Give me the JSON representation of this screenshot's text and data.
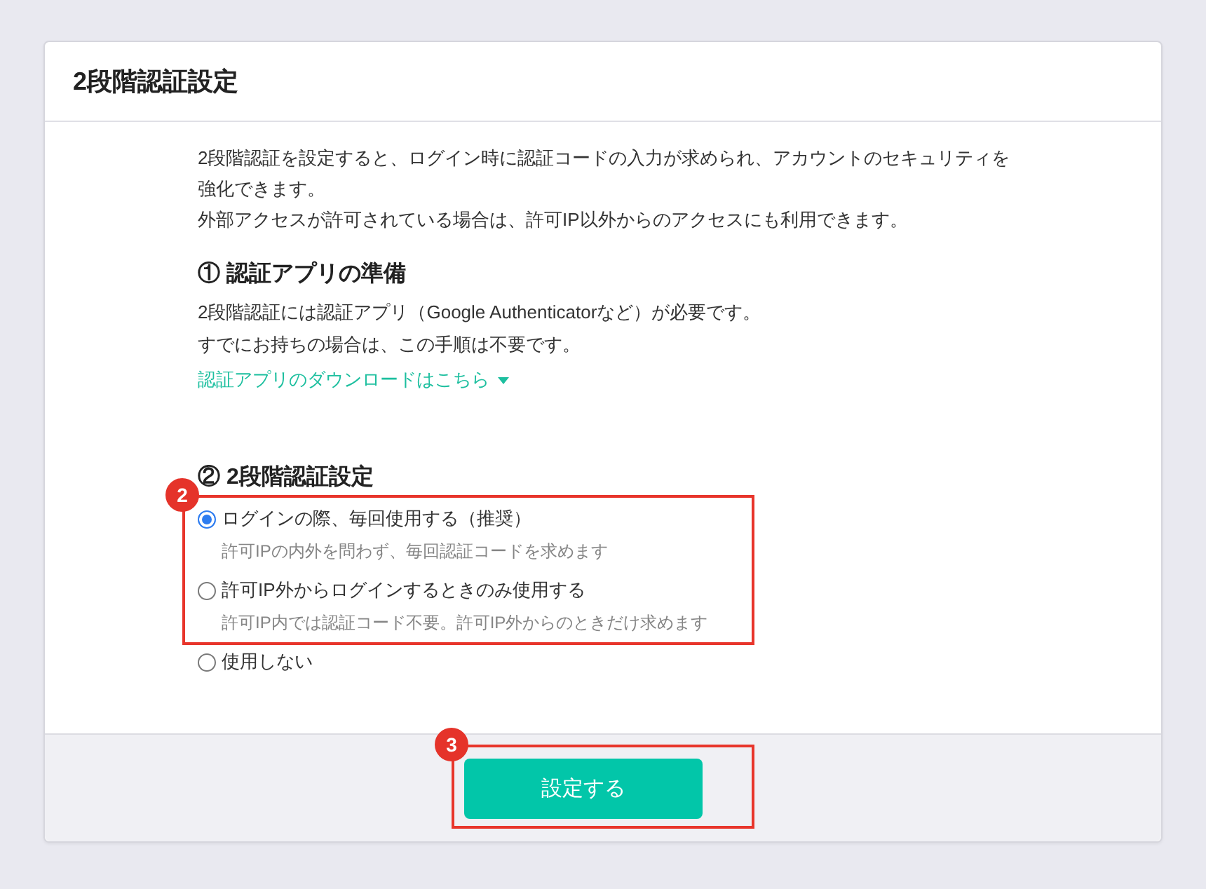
{
  "panel": {
    "title": "2段階認証設定"
  },
  "intro": [
    "2段階認証を設定すると、ログイン時に認証コードの入力が求められ、アカウントのセキュリティを強化できます。",
    "外部アクセスが許可されている場合は、許可IP以外からのアクセスにも利用できます。"
  ],
  "sections": [
    {
      "heading": "① 認証アプリの準備",
      "lines": [
        "2段階認証には認証アプリ（Google Authenticatorなど）が必要です。",
        "すでにお持ちの場合は、この手順は不要です。"
      ],
      "link": {
        "label": "認証アプリのダウンロードはこちら"
      }
    },
    {
      "heading": "② 2段階認証設定",
      "annotation_badge": "2",
      "options": [
        {
          "label": "ログインの際、毎回使用する（推奨）",
          "description": "許可IPの内外を問わず、毎回認証コードを求めます",
          "selected": true,
          "annotated": true
        },
        {
          "label": "許可IP外からログインするときのみ使用する",
          "description": "許可IP内では認証コード不要。許可IP外からのときだけ求めます",
          "selected": false,
          "annotated": true
        },
        {
          "label": "使用しない",
          "selected": false,
          "annotated": false
        }
      ]
    }
  ],
  "footer": {
    "button": {
      "label": "設定する",
      "annotation_badge": "3"
    }
  }
}
